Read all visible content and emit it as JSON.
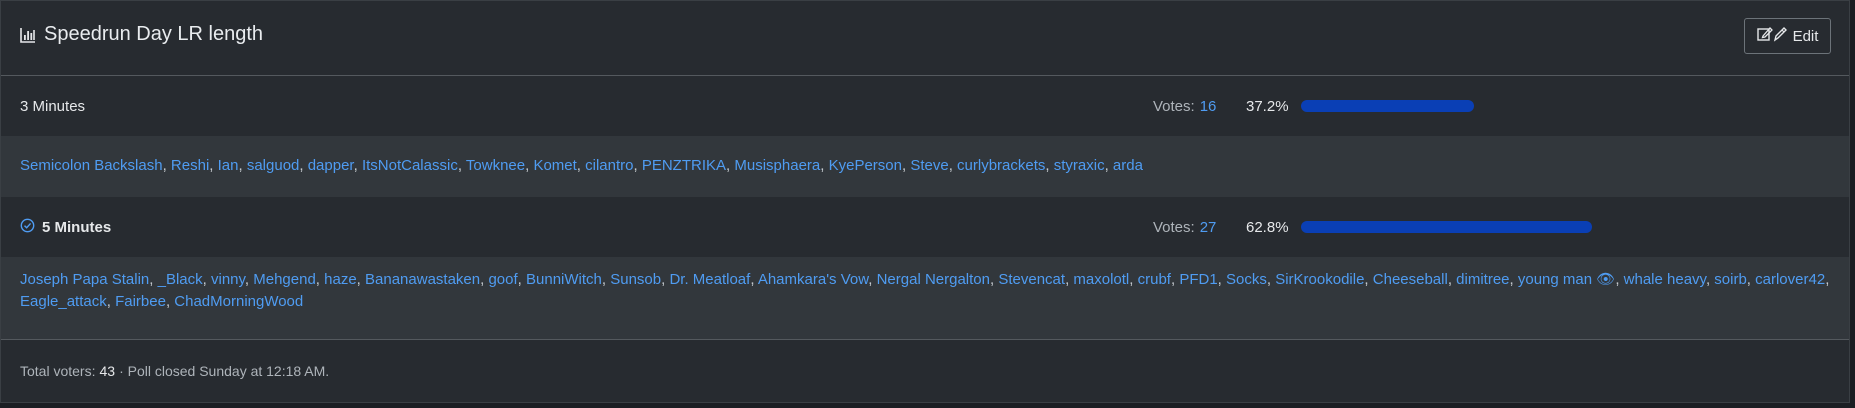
{
  "poll": {
    "title": "Speedrun Day LR length",
    "edit_label": "Edit",
    "votes_label": "Votes:",
    "options": [
      {
        "label": "3 Minutes",
        "votes": "16",
        "percent": "37.2%",
        "fraction": 0.372,
        "selected": false,
        "voters": [
          "Semicolon Backslash",
          "Reshi",
          "Ian",
          "salguod",
          "dapper",
          "ItsNotCalassic",
          "Towknee",
          "Komet",
          "cilantro",
          "PENZTRIKA",
          "Musisphaera",
          "KyePerson",
          "Steve",
          "curlybrackets",
          "styraxic",
          "arda"
        ]
      },
      {
        "label": "5 Minutes",
        "votes": "27",
        "percent": "62.8%",
        "fraction": 0.628,
        "selected": true,
        "voters": [
          "Joseph Papa Stalin",
          "_Black",
          "vinny",
          "Mehgend",
          "haze",
          "Bananawastaken",
          "goof",
          "BunniWitch",
          "Sunsob",
          "Dr. Meatloaf",
          "Ahamkara's Vow",
          "Nergal Nergalton",
          "Stevencat",
          "maxolotl",
          "crubf",
          "PFD1",
          "Socks",
          "SirKrookodile",
          "Cheeseball",
          "dimitree",
          "young man 👁",
          "whale heavy",
          "soirb",
          "carlover42",
          "Eagle_attack",
          "Fairbee",
          "ChadMorningWood"
        ]
      }
    ],
    "footer": {
      "total_label": "Total voters:",
      "total": "43",
      "status": "· Poll closed Sunday at 12:18 AM."
    }
  },
  "colors": {
    "accent": "#4f9cf2",
    "bar": "#0a3fb5",
    "panel": "#272b30",
    "alt_row": "#32373c"
  },
  "icons": {
    "title": "bar-chart-icon",
    "edit": "edit-icon",
    "selected": "check-circle-icon"
  }
}
